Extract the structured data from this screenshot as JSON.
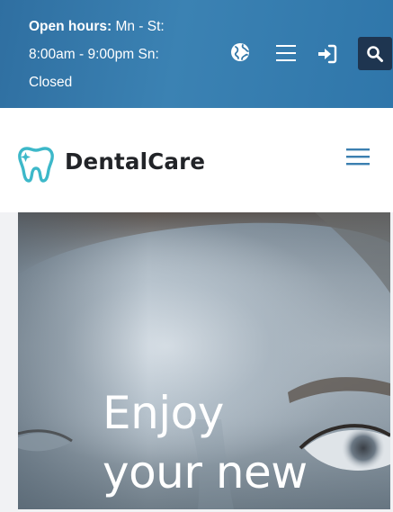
{
  "topbar": {
    "hours_label": "Open hours:",
    "hours_line1": " Mn - St:",
    "hours_line2": "8:00am - 9:00pm Sn:",
    "hours_line3": "Closed",
    "icons": [
      "globe-icon",
      "menu-icon",
      "sign-in-icon",
      "search-icon"
    ],
    "background_color": "#3478a9",
    "search_button_color": "#1e3550"
  },
  "header": {
    "brand_name": "DentalCare",
    "logo_icon": "tooth-icon",
    "logo_color": "#3db8c9",
    "menu_icon": "hamburger-icon",
    "menu_icon_color": "#3b7fb0"
  },
  "hero": {
    "headline_line1": "Enjoy",
    "headline_line2": "your new"
  }
}
